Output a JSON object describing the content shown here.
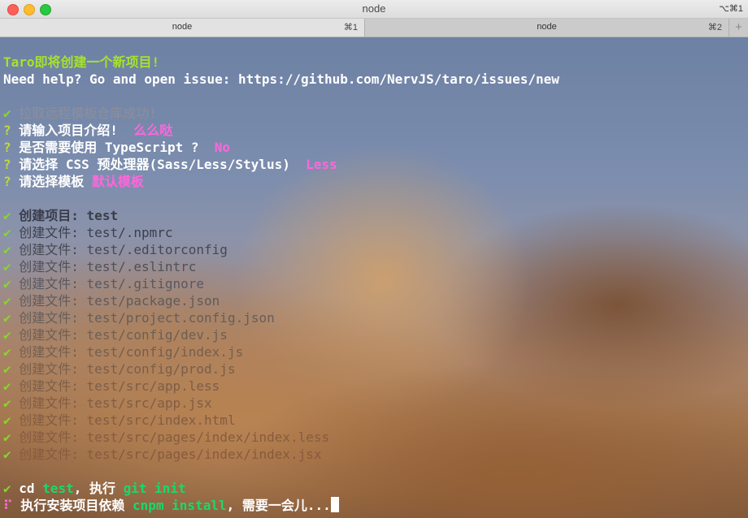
{
  "window": {
    "title": "node",
    "shortcut": "⌥⌘1"
  },
  "tabs": [
    {
      "label": "node",
      "key": "⌘1"
    },
    {
      "label": "node",
      "key": "⌘2"
    }
  ],
  "newtab_symbol": "+",
  "terminal": {
    "intro": "Taro即将创建一个新项目!",
    "help": "Need help? Go and open issue: https://github.com/NervJS/taro/issues/new",
    "check_mark": "✔",
    "question_mark": "?",
    "progress_mark": "⠏",
    "steps": {
      "fetch_template": "拉取远程模板仓库成功!",
      "intro_prompt": "请输入项目介绍! ",
      "intro_answer": "么么哒",
      "ts_prompt": "是否需要使用 TypeScript ? ",
      "ts_answer": "No",
      "css_prompt": "请选择 CSS 预处理器(Sass/Less/Stylus) ",
      "css_answer": "Less",
      "template_prompt": "请选择模板 ",
      "template_answer": "默认模板"
    },
    "created_project": "创建项目: test",
    "created_files": [
      "创建文件: test/.npmrc",
      "创建文件: test/.editorconfig",
      "创建文件: test/.eslintrc",
      "创建文件: test/.gitignore",
      "创建文件: test/package.json",
      "创建文件: test/project.config.json",
      "创建文件: test/config/dev.js",
      "创建文件: test/config/index.js",
      "创建文件: test/config/prod.js",
      "创建文件: test/src/app.less",
      "创建文件: test/src/app.jsx",
      "创建文件: test/src/index.html",
      "创建文件: test/src/pages/index/index.less",
      "创建文件: test/src/pages/index/index.jsx"
    ],
    "cd_line": {
      "prefix": "cd ",
      "dir": "test",
      "mid": ", 执行 ",
      "cmd": "git init"
    },
    "install_line": {
      "prefix": "执行安装项目依赖 ",
      "cmd": "cnpm install",
      "suffix": ", 需要一会儿..."
    },
    "colors": {
      "check": "#87d62e",
      "answer": "#ff66dd",
      "command": "#19d96b"
    }
  }
}
